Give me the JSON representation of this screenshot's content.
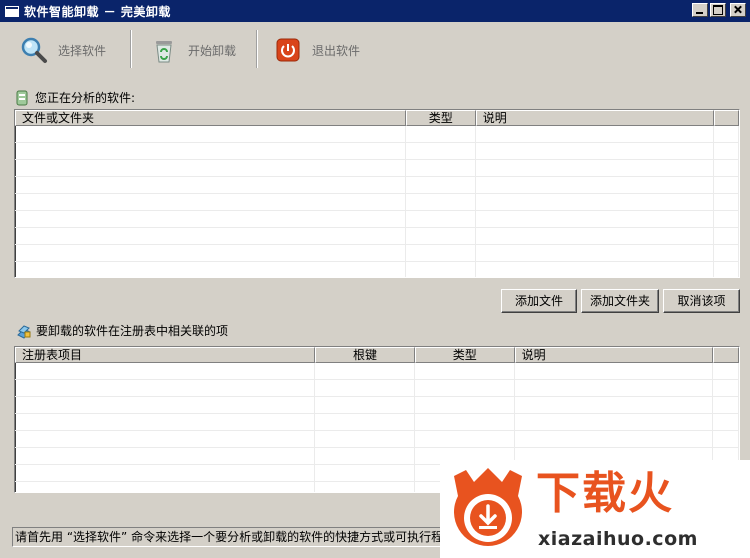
{
  "window": {
    "title": "软件智能卸载 － 完美卸载"
  },
  "toolbar": {
    "select_label": "选择软件",
    "start_label": "开始卸载",
    "exit_label": "退出软件"
  },
  "files_section": {
    "title": "您正在分析的软件:",
    "columns": [
      "文件或文件夹",
      "类型",
      "说明"
    ],
    "rows": []
  },
  "file_buttons": {
    "add_file": "添加文件",
    "add_folder": "添加文件夹",
    "cancel_item": "取消该项"
  },
  "registry_section": {
    "title": "要卸载的软件在注册表中相关联的项",
    "columns": [
      "注册表项目",
      "根键",
      "类型",
      "说明"
    ],
    "rows": []
  },
  "status": {
    "text": "请首先用 “选择软件” 命令来选择一个要分析或卸载的软件的快捷方式或可执行程序。"
  },
  "watermark": {
    "brand": "下载火",
    "url": "xiazaihuo.com"
  },
  "colors": {
    "titlebar": "#0a246a",
    "window_bg": "#d4d0c8",
    "watermark_orange": "#e8531f"
  }
}
